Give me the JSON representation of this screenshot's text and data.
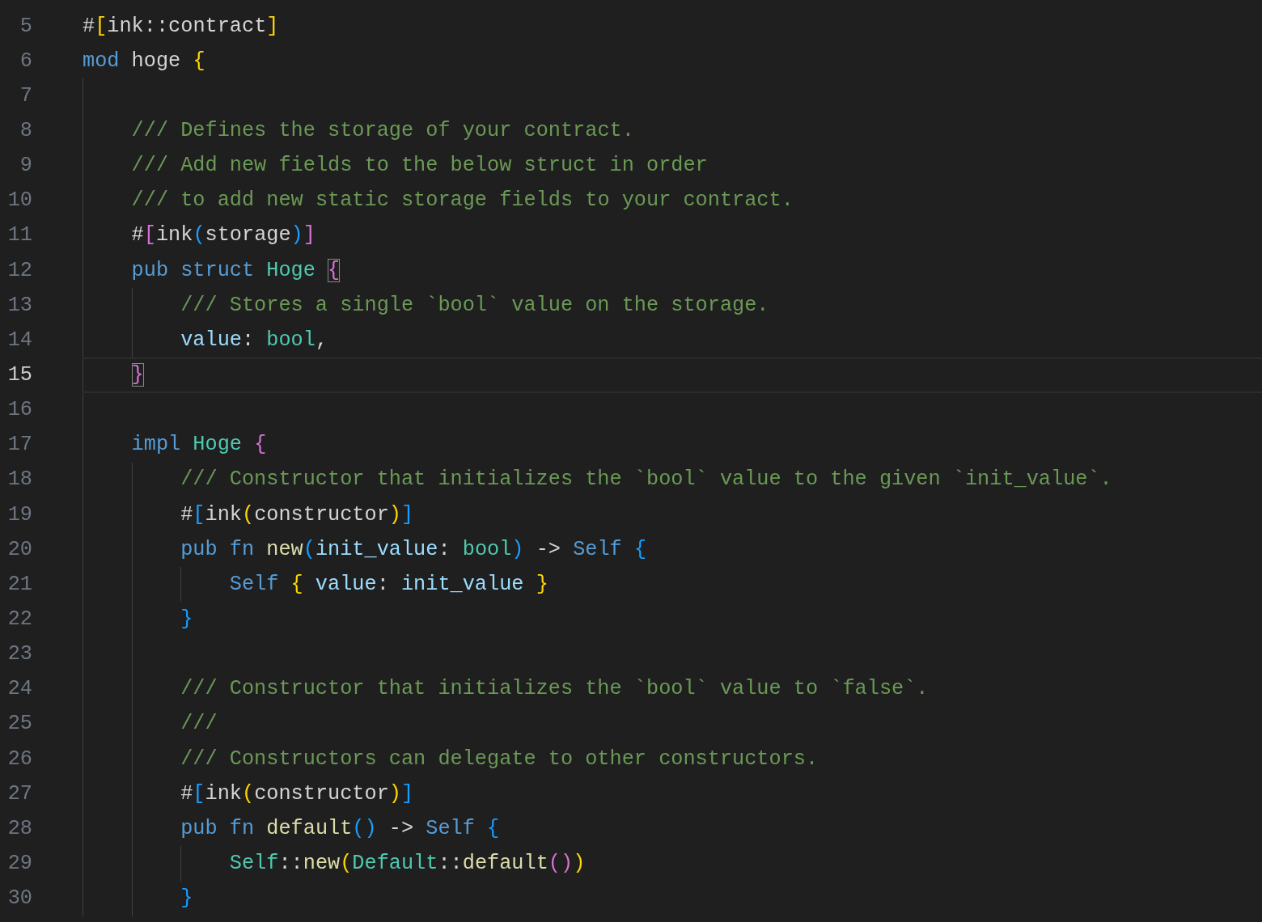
{
  "editor": {
    "lines": [
      {
        "number": "5",
        "current": false,
        "tokens": [
          {
            "text": "#",
            "kind": "plain"
          },
          {
            "text": "[",
            "kind": "bracket1"
          },
          {
            "text": "ink::contract",
            "kind": "plain"
          },
          {
            "text": "]",
            "kind": "bracket1"
          }
        ]
      },
      {
        "number": "6",
        "current": false,
        "tokens": [
          {
            "text": "mod",
            "kind": "keyword"
          },
          {
            "text": " hoge ",
            "kind": "plain"
          },
          {
            "text": "{",
            "kind": "bracket1"
          }
        ]
      },
      {
        "number": "7",
        "current": false
      },
      {
        "number": "8",
        "current": false,
        "tokens": [
          {
            "text": "    /// Defines the storage of your contract.",
            "kind": "comment"
          }
        ]
      },
      {
        "number": "9",
        "current": false,
        "tokens": [
          {
            "text": "    /// Add new fields to the below struct in order",
            "kind": "comment"
          }
        ]
      },
      {
        "number": "10",
        "current": false,
        "tokens": [
          {
            "text": "    /// to add new static storage fields to your contract.",
            "kind": "comment"
          }
        ]
      },
      {
        "number": "11",
        "current": false,
        "tokens": [
          {
            "text": "    #",
            "kind": "plain"
          },
          {
            "text": "[",
            "kind": "bracket2"
          },
          {
            "text": "ink",
            "kind": "plain"
          },
          {
            "text": "(",
            "kind": "bracket3"
          },
          {
            "text": "storage",
            "kind": "plain"
          },
          {
            "text": ")",
            "kind": "bracket3"
          },
          {
            "text": "]",
            "kind": "bracket2"
          }
        ]
      },
      {
        "number": "12",
        "current": false,
        "tokens": [
          {
            "text": "    pub struct ",
            "kind": "keyword"
          },
          {
            "text": "Hoge ",
            "kind": "type"
          },
          {
            "text": "{",
            "kind": "bracket2",
            "boxed": true
          }
        ]
      },
      {
        "number": "13",
        "current": false,
        "tokens": [
          {
            "text": "        /// Stores a single `bool` value on the storage.",
            "kind": "comment"
          }
        ]
      },
      {
        "number": "14",
        "current": false,
        "tokens": [
          {
            "text": "        value",
            "kind": "variable"
          },
          {
            "text": ": ",
            "kind": "plain"
          },
          {
            "text": "bool",
            "kind": "type"
          },
          {
            "text": ",",
            "kind": "plain"
          }
        ]
      },
      {
        "number": "15",
        "current": true,
        "tokens": [
          {
            "text": "    }",
            "kind": "bracket2",
            "boxed": true
          }
        ]
      },
      {
        "number": "16",
        "current": false
      },
      {
        "number": "17",
        "current": false,
        "tokens": [
          {
            "text": "    impl ",
            "kind": "keyword"
          },
          {
            "text": "Hoge ",
            "kind": "type"
          },
          {
            "text": "{",
            "kind": "bracket2"
          }
        ]
      },
      {
        "number": "18",
        "current": false,
        "tokens": [
          {
            "text": "        /// Constructor that initializes the `bool` value to the given `init_value`.",
            "kind": "comment"
          }
        ]
      },
      {
        "number": "19",
        "current": false,
        "tokens": [
          {
            "text": "        #",
            "kind": "plain"
          },
          {
            "text": "[",
            "kind": "bracket3"
          },
          {
            "text": "ink",
            "kind": "plain"
          },
          {
            "text": "(",
            "kind": "bracket1"
          },
          {
            "text": "constructor",
            "kind": "plain"
          },
          {
            "text": ")",
            "kind": "bracket1"
          },
          {
            "text": "]",
            "kind": "bracket3"
          }
        ]
      },
      {
        "number": "20",
        "current": false,
        "tokens": [
          {
            "text": "        pub fn ",
            "kind": "keyword"
          },
          {
            "text": "new",
            "kind": "function"
          },
          {
            "text": "(",
            "kind": "bracket3"
          },
          {
            "text": "init_value",
            "kind": "variable"
          },
          {
            "text": ": ",
            "kind": "plain"
          },
          {
            "text": "bool",
            "kind": "type"
          },
          {
            "text": ")",
            "kind": "bracket3"
          },
          {
            "text": " -> ",
            "kind": "plain"
          },
          {
            "text": "Self ",
            "kind": "keyword"
          },
          {
            "text": "{",
            "kind": "bracket3"
          }
        ]
      },
      {
        "number": "21",
        "current": false,
        "tokens": [
          {
            "text": "            Self ",
            "kind": "keyword"
          },
          {
            "text": "{",
            "kind": "bracket1"
          },
          {
            "text": " value",
            "kind": "variable"
          },
          {
            "text": ": ",
            "kind": "plain"
          },
          {
            "text": "init_value ",
            "kind": "variable"
          },
          {
            "text": "}",
            "kind": "bracket1"
          }
        ]
      },
      {
        "number": "22",
        "current": false,
        "tokens": [
          {
            "text": "        }",
            "kind": "bracket3"
          }
        ]
      },
      {
        "number": "23",
        "current": false
      },
      {
        "number": "24",
        "current": false,
        "tokens": [
          {
            "text": "        /// Constructor that initializes the `bool` value to `false`.",
            "kind": "comment"
          }
        ]
      },
      {
        "number": "25",
        "current": false,
        "tokens": [
          {
            "text": "        ///",
            "kind": "comment"
          }
        ]
      },
      {
        "number": "26",
        "current": false,
        "tokens": [
          {
            "text": "        /// Constructors can delegate to other constructors.",
            "kind": "comment"
          }
        ]
      },
      {
        "number": "27",
        "current": false,
        "tokens": [
          {
            "text": "        #",
            "kind": "plain"
          },
          {
            "text": "[",
            "kind": "bracket3"
          },
          {
            "text": "ink",
            "kind": "plain"
          },
          {
            "text": "(",
            "kind": "bracket1"
          },
          {
            "text": "constructor",
            "kind": "plain"
          },
          {
            "text": ")",
            "kind": "bracket1"
          },
          {
            "text": "]",
            "kind": "bracket3"
          }
        ]
      },
      {
        "number": "28",
        "current": false,
        "tokens": [
          {
            "text": "        pub fn ",
            "kind": "keyword"
          },
          {
            "text": "default",
            "kind": "function"
          },
          {
            "text": "()",
            "kind": "bracket3"
          },
          {
            "text": " -> ",
            "kind": "plain"
          },
          {
            "text": "Self ",
            "kind": "keyword"
          },
          {
            "text": "{",
            "kind": "bracket3"
          }
        ]
      },
      {
        "number": "29",
        "current": false,
        "tokens": [
          {
            "text": "            Self",
            "kind": "type"
          },
          {
            "text": "::",
            "kind": "plain"
          },
          {
            "text": "new",
            "kind": "function"
          },
          {
            "text": "(",
            "kind": "bracket1"
          },
          {
            "text": "Default",
            "kind": "type"
          },
          {
            "text": "::",
            "kind": "plain"
          },
          {
            "text": "default",
            "kind": "function"
          },
          {
            "text": "()",
            "kind": "bracket2"
          },
          {
            "text": ")",
            "kind": "bracket1"
          }
        ]
      },
      {
        "number": "30",
        "current": false,
        "tokens": [
          {
            "text": "        }",
            "kind": "bracket3"
          }
        ]
      }
    ]
  }
}
